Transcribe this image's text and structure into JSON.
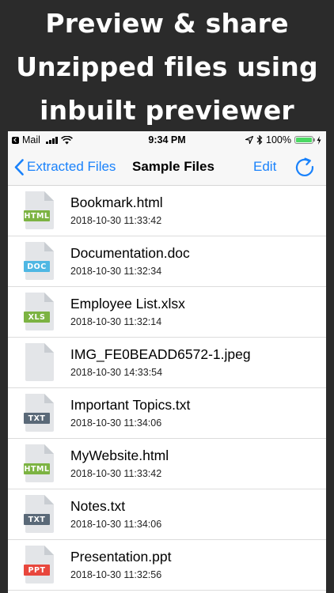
{
  "headline": {
    "line1": "Preview & share",
    "line2": "Unzipped files using",
    "line3": "inbuilt previewer"
  },
  "status_bar": {
    "back_app": "Mail",
    "time": "9:34 PM",
    "battery": "100%",
    "battery_level": 1.0
  },
  "nav": {
    "back_label": "Extracted Files",
    "title": "Sample Files",
    "edit_label": "Edit"
  },
  "files": [
    {
      "name": "Bookmark.html",
      "date": "2018-10-30 11:33:42",
      "badge": "HTML",
      "badge_color": "#7cb342"
    },
    {
      "name": "Documentation.doc",
      "date": "2018-10-30 11:32:34",
      "badge": "DOC",
      "badge_color": "#4fb7e3"
    },
    {
      "name": "Employee List.xlsx",
      "date": "2018-10-30 11:32:14",
      "badge": "XLS",
      "badge_color": "#7cb342"
    },
    {
      "name": "IMG_FE0BEADD6572-1.jpeg",
      "date": "2018-10-30 14:33:54",
      "badge": "",
      "badge_color": ""
    },
    {
      "name": "Important Topics.txt",
      "date": "2018-10-30 11:34:06",
      "badge": "TXT",
      "badge_color": "#5a6978"
    },
    {
      "name": "MyWebsite.html",
      "date": "2018-10-30 11:33:42",
      "badge": "HTML",
      "badge_color": "#7cb342"
    },
    {
      "name": "Notes.txt",
      "date": "2018-10-30 11:34:06",
      "badge": "TXT",
      "badge_color": "#5a6978"
    },
    {
      "name": "Presentation.ppt",
      "date": "2018-10-30 11:32:56",
      "badge": "PPT",
      "badge_color": "#e8473d"
    }
  ],
  "colors": {
    "accent": "#1a82fb",
    "page_background": "#2b2b2b",
    "bar_background": "#f7f7f7"
  }
}
